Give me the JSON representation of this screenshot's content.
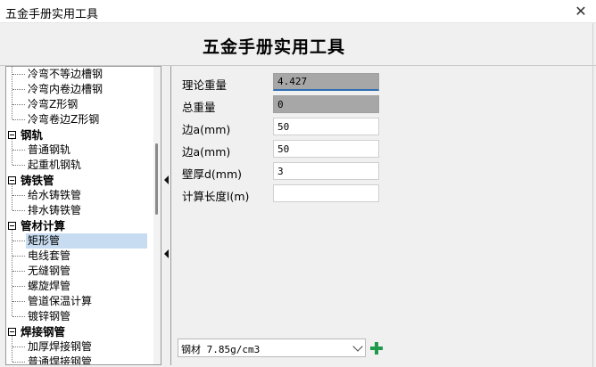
{
  "window": {
    "title": "五金手册实用工具"
  },
  "header": {
    "title": "五金手册实用工具"
  },
  "tree": {
    "nodes": [
      {
        "label": "冷弯不等边槽钢",
        "level": 1
      },
      {
        "label": "冷弯内卷边槽钢",
        "level": 1
      },
      {
        "label": "冷弯Z形钢",
        "level": 1
      },
      {
        "label": "冷弯卷边Z形钢",
        "level": 1
      },
      {
        "label": "钢轨",
        "level": 0
      },
      {
        "label": "普通钢轨",
        "level": 1
      },
      {
        "label": "起重机钢轨",
        "level": 1
      },
      {
        "label": "铸铁管",
        "level": 0
      },
      {
        "label": "给水铸铁管",
        "level": 1
      },
      {
        "label": "排水铸铁管",
        "level": 1
      },
      {
        "label": "管材计算",
        "level": 0
      },
      {
        "label": "矩形管",
        "level": 1,
        "selected": true
      },
      {
        "label": "电线套管",
        "level": 1
      },
      {
        "label": "无缝钢管",
        "level": 1
      },
      {
        "label": "螺旋焊管",
        "level": 1
      },
      {
        "label": "管道保温计算",
        "level": 1
      },
      {
        "label": "镀锌钢管",
        "level": 1
      },
      {
        "label": "焊接钢管",
        "level": 0
      },
      {
        "label": "加厚焊接钢管",
        "level": 1
      },
      {
        "label": "普通焊接钢管",
        "level": 1
      }
    ]
  },
  "form": {
    "fields": [
      {
        "label": "理论重量",
        "value": "4.427",
        "readonly": true,
        "focused": true
      },
      {
        "label": "总重量",
        "value": "0",
        "readonly": true
      },
      {
        "label": "边a(mm)",
        "value": "50"
      },
      {
        "label": "边a(mm)",
        "value": "50"
      },
      {
        "label": "壁厚d(mm)",
        "value": "3"
      },
      {
        "label": "计算长度l(m)",
        "value": ""
      }
    ]
  },
  "material": {
    "selected": "钢材 7.85g/cm3"
  },
  "icons": {
    "close": "close-icon",
    "add": "plus-icon"
  },
  "colors": {
    "selection": "#c7dcf1",
    "readonly_field": "#a7a7a7",
    "add_icon": "#1f9a4a"
  }
}
